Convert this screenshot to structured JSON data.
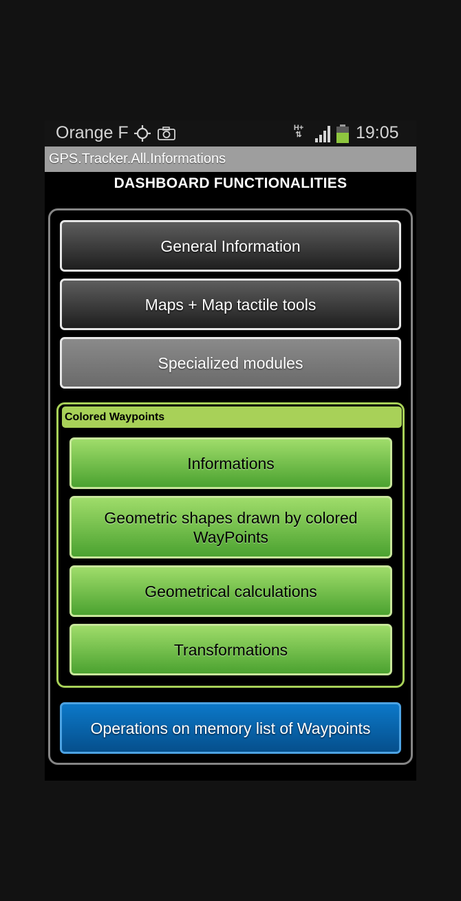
{
  "status_bar": {
    "carrier": "Orange F",
    "network_type": "H+",
    "time": "19:05",
    "icons": [
      "locate-icon",
      "camera-icon",
      "hplus-icon",
      "signal-icon",
      "battery-icon"
    ]
  },
  "app": {
    "title": "GPS.Tracker.All.Informations"
  },
  "dashboard": {
    "heading": "DASHBOARD FUNCTIONALITIES",
    "buttons": [
      {
        "label": "General Information"
      },
      {
        "label": "Maps + Map tactile tools"
      },
      {
        "label": "Specialized modules"
      }
    ],
    "colored_waypoints": {
      "title": "Colored Waypoints",
      "buttons": [
        {
          "label": "Informations"
        },
        {
          "label": "Geometric shapes drawn by colored WayPoints"
        },
        {
          "label": "Geometrical calculations"
        },
        {
          "label": "Transformations"
        }
      ]
    },
    "bottom_button": {
      "label": "Operations on memory list of Waypoints"
    }
  },
  "colors": {
    "dark_button": "#3a3a3a",
    "gray_button": "#7a7a7a",
    "green_accent": "#a8d158",
    "green_button": "#6fc048",
    "blue_button": "#0a68b0"
  }
}
